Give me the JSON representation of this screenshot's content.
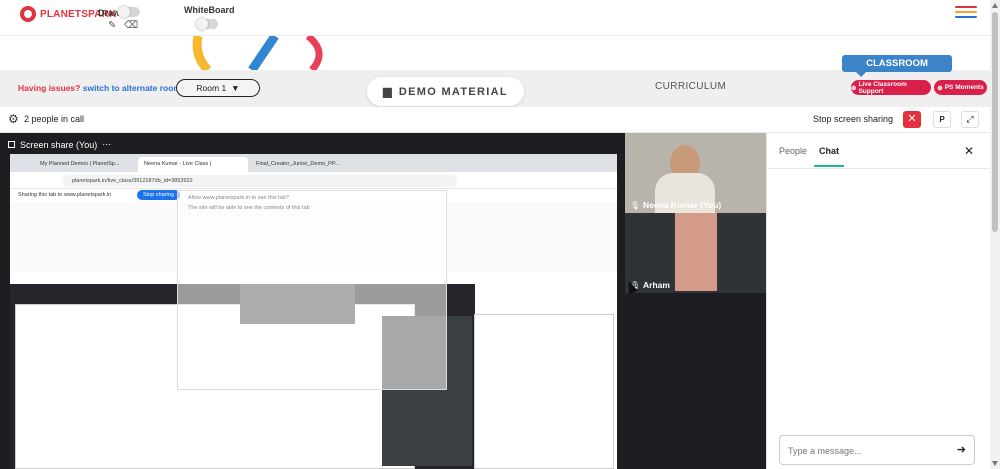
{
  "topbar": {
    "brand": "PLANETSPARK",
    "draw_label": "Draw",
    "whiteboard_label": "WhiteBoard",
    "menu_colors": [
      "#e3313f",
      "#f5a623",
      "#2f6fd3"
    ]
  },
  "room_bar": {
    "issues_text": "Having issues?",
    "switch_text": "switch to alternate room",
    "room_value": "Room 1",
    "demo_material": "DEMO MATERIAL",
    "curriculum": "CURRICULUM",
    "classroom_badge": "CLASSROOM",
    "live_support": "Live Classroom Support",
    "ps_moments": "PS Moments"
  },
  "call_bar": {
    "people_count": "2 people in call",
    "stop_sharing": "Stop screen sharing",
    "p_button": "P"
  },
  "screen_share": {
    "title": "Screen share (You)",
    "inner": {
      "tabs": [
        "My Planned Demos | PlanetSp...",
        "Neena Kumar - Live Class | ",
        "Final_Creator_Junior_Demo_PP..."
      ],
      "address": "planetspark.in/live_class/3912187db_id=3853922",
      "share_notice": "Sharing this tab to www.planetspark.in",
      "stop_sharing_btn": "Stop sharing",
      "dialog_title": "Allow www.planetspark.in to see this tab?",
      "dialog_body": "The site will be able to see the contents of this tab"
    }
  },
  "videos": [
    {
      "name": "Neena Kumar (You)"
    },
    {
      "name": "Arham"
    }
  ],
  "side_panel": {
    "tab_people": "People",
    "tab_chat": "Chat",
    "message_placeholder": "Type a message..."
  },
  "colors": {
    "brand_red": "#e3313f",
    "accent_blue": "#3a84c7",
    "pill_pink": "#d9204a",
    "teal": "#1fb6a3"
  }
}
